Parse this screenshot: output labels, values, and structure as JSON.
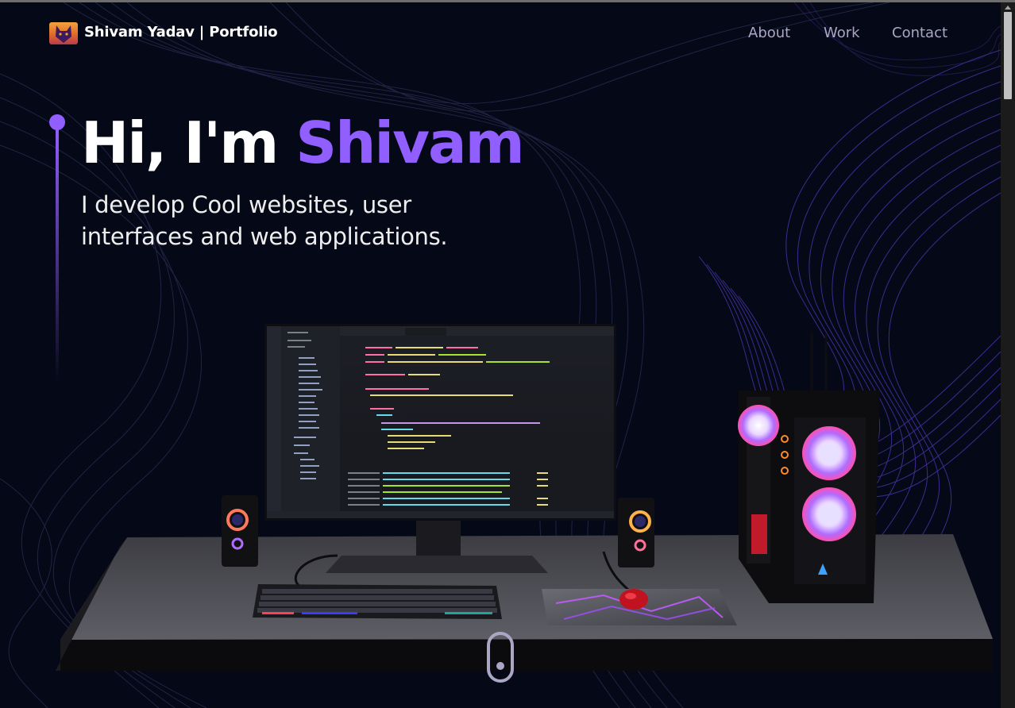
{
  "brand": {
    "title": "Shivam Yadav | Portfolio",
    "logo_icon": "cat-logo-icon"
  },
  "nav": {
    "links": [
      {
        "label": "About"
      },
      {
        "label": "Work"
      },
      {
        "label": "Contact"
      }
    ]
  },
  "hero": {
    "greeting": "Hi, I'm ",
    "name": "Shivam",
    "subtitle_line1": "I develop Cool websites, user",
    "subtitle_line2": "interfaces and web applications."
  },
  "colors": {
    "background": "#050816",
    "accent": "#915eff",
    "nav_text": "#aaa6c3"
  },
  "scroll_indicator": {
    "icon": "mouse-scroll-icon"
  }
}
